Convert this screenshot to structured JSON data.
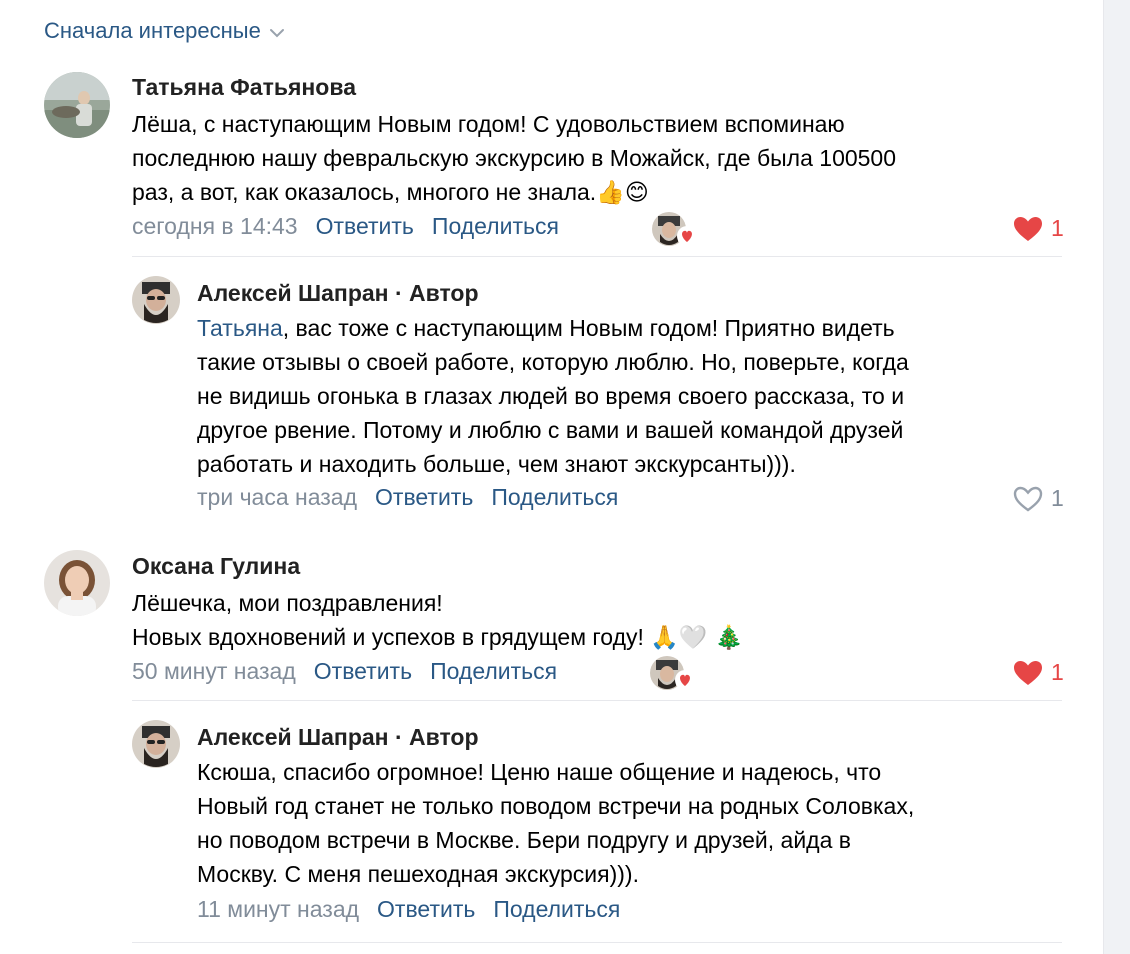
{
  "sort": {
    "label": "Сначала интересные"
  },
  "colors": {
    "link": "#2a5885",
    "muted": "#818c99",
    "like_active": "#e64646"
  },
  "comments": [
    {
      "author": "Татьяна Фатьянова",
      "lines": [
        "Лёша, с наступающим Новым годом! С удовольствием вспоминаю",
        "последнюю нашу февральскую экскурсию в Можайск, где была 100500",
        "раз, а вот, как оказалось, многого не знала."
      ],
      "emoji": "👍😊",
      "date": "сегодня в 14:43",
      "reply_label": "Ответить",
      "share_label": "Поделиться",
      "likes": "1",
      "liked": true
    },
    {
      "author": "Алексей Шапран",
      "author_role": " · Автор",
      "mention": "Татьяна",
      "lines": [
        ", вас тоже с наступающим Новым годом! Приятно видеть",
        "такие отзывы о своей работе, которую люблю. Но, поверьте, когда",
        "не видишь огонька в глазах людей во время своего рассказа, то и",
        "другое рвение. Потому и люблю с вами и вашей командой друзей",
        "работать и находить больше, чем знают экскурсанты)))."
      ],
      "date": "три часа назад",
      "reply_label": "Ответить",
      "share_label": "Поделиться",
      "likes": "1",
      "liked": false
    },
    {
      "author": "Оксана Гулина",
      "lines": [
        "Лёшечка, мои поздравления!",
        "Новых вдохновений и успехов в грядущем году!"
      ],
      "emoji": "🙏🤍 🎄",
      "date": "50 минут назад",
      "reply_label": "Ответить",
      "share_label": "Поделиться",
      "likes": "1",
      "liked": true
    },
    {
      "author": "Алексей Шапран",
      "author_role": " · Автор",
      "lines": [
        "Ксюша, спасибо огромное! Ценю наше общение и надеюсь, что",
        "Новый год станет не только поводом встречи на родных Соловках,",
        "но поводом встречи в Москве. Бери подругу и друзей, айда в",
        "Москву. С меня пешеходная экскурсия)))."
      ],
      "date": "11 минут назад",
      "reply_label": "Ответить",
      "share_label": "Поделиться"
    }
  ]
}
